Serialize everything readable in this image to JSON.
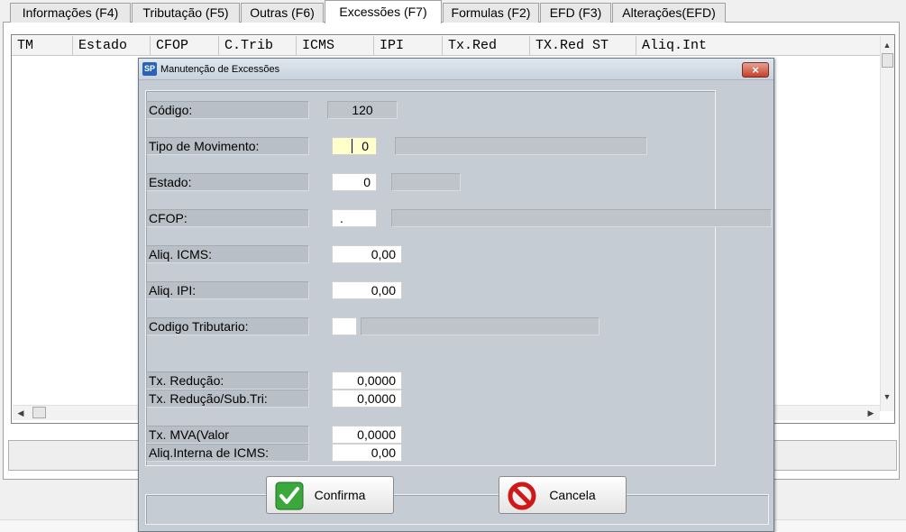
{
  "tabs": [
    {
      "label": "Informações (F4)"
    },
    {
      "label": "Tributação (F5)"
    },
    {
      "label": "Outras (F6)"
    },
    {
      "label": "Excessões (F7)"
    },
    {
      "label": "Formulas (F2)"
    },
    {
      "label": "EFD (F3)"
    },
    {
      "label": "Alterações(EFD)"
    }
  ],
  "grid": {
    "columns": [
      "TM",
      "Estado",
      "CFOP",
      "C.Trib",
      "ICMS",
      "IPI",
      "Tx.Red",
      "TX.Red ST",
      "Aliq.Int"
    ]
  },
  "dialog": {
    "title": "Manutenção de Excessões",
    "app_icon": "SP",
    "close": "×",
    "codigo_label": "Código:",
    "codigo_value": "120",
    "tipo_label": "Tipo de Movimento:",
    "tipo_value": "0",
    "estado_label": "Estado:",
    "estado_value": "0",
    "cfop_label": "CFOP:",
    "cfop_value": ".",
    "aliq_icms_label": "Aliq. ICMS:",
    "aliq_icms_value": "0,00",
    "aliq_ipi_label": "Aliq. IPI:",
    "aliq_ipi_value": "0,00",
    "cod_trib_label": "Codigo Tributario:",
    "cod_trib_value": "",
    "tx_red_label": "Tx. Redução:",
    "tx_red_value": "0,0000",
    "tx_red_st_label": "Tx. Redução/Sub.Tri:",
    "tx_red_st_value": "0,0000",
    "tx_mva_label": "Tx. MVA(Valor",
    "tx_mva_value": "0,0000",
    "aliq_int_label": "Aliq.Interna de ICMS:",
    "aliq_int_value": "0,00",
    "confirm_label": "Confirma",
    "cancel_label": "Cancela"
  }
}
